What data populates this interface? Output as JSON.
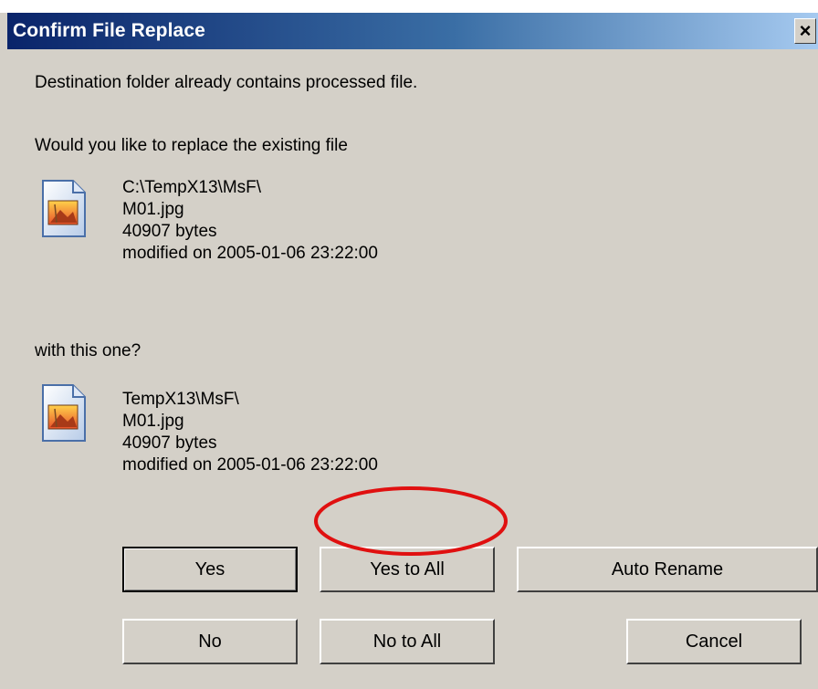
{
  "window": {
    "title": "Confirm File Replace",
    "close_glyph": "×"
  },
  "message": {
    "line1": "Destination folder already contains processed file.",
    "line2": "Would you like to replace the existing file",
    "line3": "with this one?"
  },
  "existing_file": {
    "path": "C:\\TempX13\\MsF\\",
    "name": "M01.jpg",
    "size": "40907 bytes",
    "modified": "modified on 2005-01-06 23:22:00",
    "icon": "image-file-icon"
  },
  "new_file": {
    "path": "TempX13\\MsF\\",
    "name": "M01.jpg",
    "size": "40907 bytes",
    "modified": "modified on 2005-01-06 23:22:00",
    "icon": "image-file-icon"
  },
  "buttons": {
    "yes": "Yes",
    "yes_to_all": "Yes to All",
    "auto_rename": "Auto Rename",
    "no": "No",
    "no_to_all": "No to All",
    "cancel": "Cancel"
  },
  "colors": {
    "dialog_bg": "#d4d0c8",
    "titlebar_start": "#0a246a",
    "titlebar_end": "#a6caf0",
    "annotation": "#e01010"
  }
}
